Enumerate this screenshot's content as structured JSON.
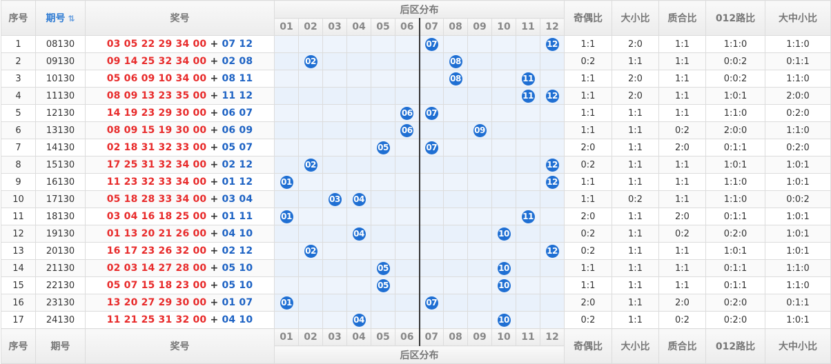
{
  "header": {
    "seq": "序号",
    "issue": "期号",
    "sort_icon": "sort-icon",
    "prize": "奖号",
    "back_title": "后区分布",
    "odd_even": "奇偶比",
    "big_small": "大小比",
    "prime_composite": "质合比",
    "road_012": "012路比",
    "big_mid_small": "大中小比",
    "nums": [
      "01",
      "02",
      "03",
      "04",
      "05",
      "06",
      "07",
      "08",
      "09",
      "10",
      "11",
      "12"
    ]
  },
  "colors": {
    "front": "#e82b2b",
    "back": "#1e63c4",
    "ball": "#1f6fd3",
    "accent_link": "#2e7bd3"
  },
  "rows": [
    {
      "seq": "1",
      "issue": "08130",
      "front": "03 05 22 29 34 00",
      "plus": "+",
      "back": "07 12",
      "b1": "07",
      "b2": "12",
      "oe": "1:1",
      "bs": "2:0",
      "pc": "1:1",
      "r012": "1:1:0",
      "bms": "1:1:0"
    },
    {
      "seq": "2",
      "issue": "09130",
      "front": "09 14 25 32 34 00",
      "plus": "+",
      "back": "02 08",
      "b1": "02",
      "b2": "08",
      "oe": "0:2",
      "bs": "1:1",
      "pc": "1:1",
      "r012": "0:0:2",
      "bms": "0:1:1"
    },
    {
      "seq": "3",
      "issue": "10130",
      "front": "05 06 09 10 34 00",
      "plus": "+",
      "back": "08 11",
      "b1": "08",
      "b2": "11",
      "oe": "1:1",
      "bs": "2:0",
      "pc": "1:1",
      "r012": "0:0:2",
      "bms": "1:1:0"
    },
    {
      "seq": "4",
      "issue": "11130",
      "front": "08 09 13 23 35 00",
      "plus": "+",
      "back": "11 12",
      "b1": "11",
      "b2": "12",
      "oe": "1:1",
      "bs": "2:0",
      "pc": "1:1",
      "r012": "1:0:1",
      "bms": "2:0:0"
    },
    {
      "seq": "5",
      "issue": "12130",
      "front": "14 19 23 29 30 00",
      "plus": "+",
      "back": "06 07",
      "b1": "06",
      "b2": "07",
      "oe": "1:1",
      "bs": "1:1",
      "pc": "1:1",
      "r012": "1:1:0",
      "bms": "0:2:0"
    },
    {
      "seq": "6",
      "issue": "13130",
      "front": "08 09 15 19 30 00",
      "plus": "+",
      "back": "06 09",
      "b1": "06",
      "b2": "09",
      "oe": "1:1",
      "bs": "1:1",
      "pc": "0:2",
      "r012": "2:0:0",
      "bms": "1:1:0"
    },
    {
      "seq": "7",
      "issue": "14130",
      "front": "02 18 31 32 33 00",
      "plus": "+",
      "back": "05 07",
      "b1": "05",
      "b2": "07",
      "oe": "2:0",
      "bs": "1:1",
      "pc": "2:0",
      "r012": "0:1:1",
      "bms": "0:2:0"
    },
    {
      "seq": "8",
      "issue": "15130",
      "front": "17 25 31 32 34 00",
      "plus": "+",
      "back": "02 12",
      "b1": "02",
      "b2": "12",
      "oe": "0:2",
      "bs": "1:1",
      "pc": "1:1",
      "r012": "1:0:1",
      "bms": "1:0:1"
    },
    {
      "seq": "9",
      "issue": "16130",
      "front": "11 23 32 33 34 00",
      "plus": "+",
      "back": "01 12",
      "b1": "01",
      "b2": "12",
      "oe": "1:1",
      "bs": "1:1",
      "pc": "1:1",
      "r012": "1:1:0",
      "bms": "1:0:1"
    },
    {
      "seq": "10",
      "issue": "17130",
      "front": "05 18 28 33 34 00",
      "plus": "+",
      "back": "03 04",
      "b1": "03",
      "b2": "04",
      "oe": "1:1",
      "bs": "0:2",
      "pc": "1:1",
      "r012": "1:1:0",
      "bms": "0:0:2"
    },
    {
      "seq": "11",
      "issue": "18130",
      "front": "03 04 16 18 25 00",
      "plus": "+",
      "back": "01 11",
      "b1": "01",
      "b2": "11",
      "oe": "2:0",
      "bs": "1:1",
      "pc": "2:0",
      "r012": "0:1:1",
      "bms": "1:0:1"
    },
    {
      "seq": "12",
      "issue": "19130",
      "front": "01 13 20 21 26 00",
      "plus": "+",
      "back": "04 10",
      "b1": "04",
      "b2": "10",
      "oe": "0:2",
      "bs": "1:1",
      "pc": "0:2",
      "r012": "0:2:0",
      "bms": "1:0:1"
    },
    {
      "seq": "13",
      "issue": "20130",
      "front": "16 17 23 26 32 00",
      "plus": "+",
      "back": "02 12",
      "b1": "02",
      "b2": "12",
      "oe": "0:2",
      "bs": "1:1",
      "pc": "1:1",
      "r012": "1:0:1",
      "bms": "1:0:1"
    },
    {
      "seq": "14",
      "issue": "21130",
      "front": "02 03 14 27 28 00",
      "plus": "+",
      "back": "05 10",
      "b1": "05",
      "b2": "10",
      "oe": "1:1",
      "bs": "1:1",
      "pc": "1:1",
      "r012": "0:1:1",
      "bms": "1:1:0"
    },
    {
      "seq": "15",
      "issue": "22130",
      "front": "05 07 15 18 23 00",
      "plus": "+",
      "back": "05 10",
      "b1": "05",
      "b2": "10",
      "oe": "1:1",
      "bs": "1:1",
      "pc": "1:1",
      "r012": "0:1:1",
      "bms": "1:1:0"
    },
    {
      "seq": "16",
      "issue": "23130",
      "front": "13 20 27 29 30 00",
      "plus": "+",
      "back": "01 07",
      "b1": "01",
      "b2": "07",
      "oe": "2:0",
      "bs": "1:1",
      "pc": "2:0",
      "r012": "0:2:0",
      "bms": "0:1:1"
    },
    {
      "seq": "17",
      "issue": "24130",
      "front": "11 21 25 31 32 00",
      "plus": "+",
      "back": "04 10",
      "b1": "04",
      "b2": "10",
      "oe": "0:2",
      "bs": "1:1",
      "pc": "0:2",
      "r012": "0:2:0",
      "bms": "1:0:1"
    }
  ]
}
